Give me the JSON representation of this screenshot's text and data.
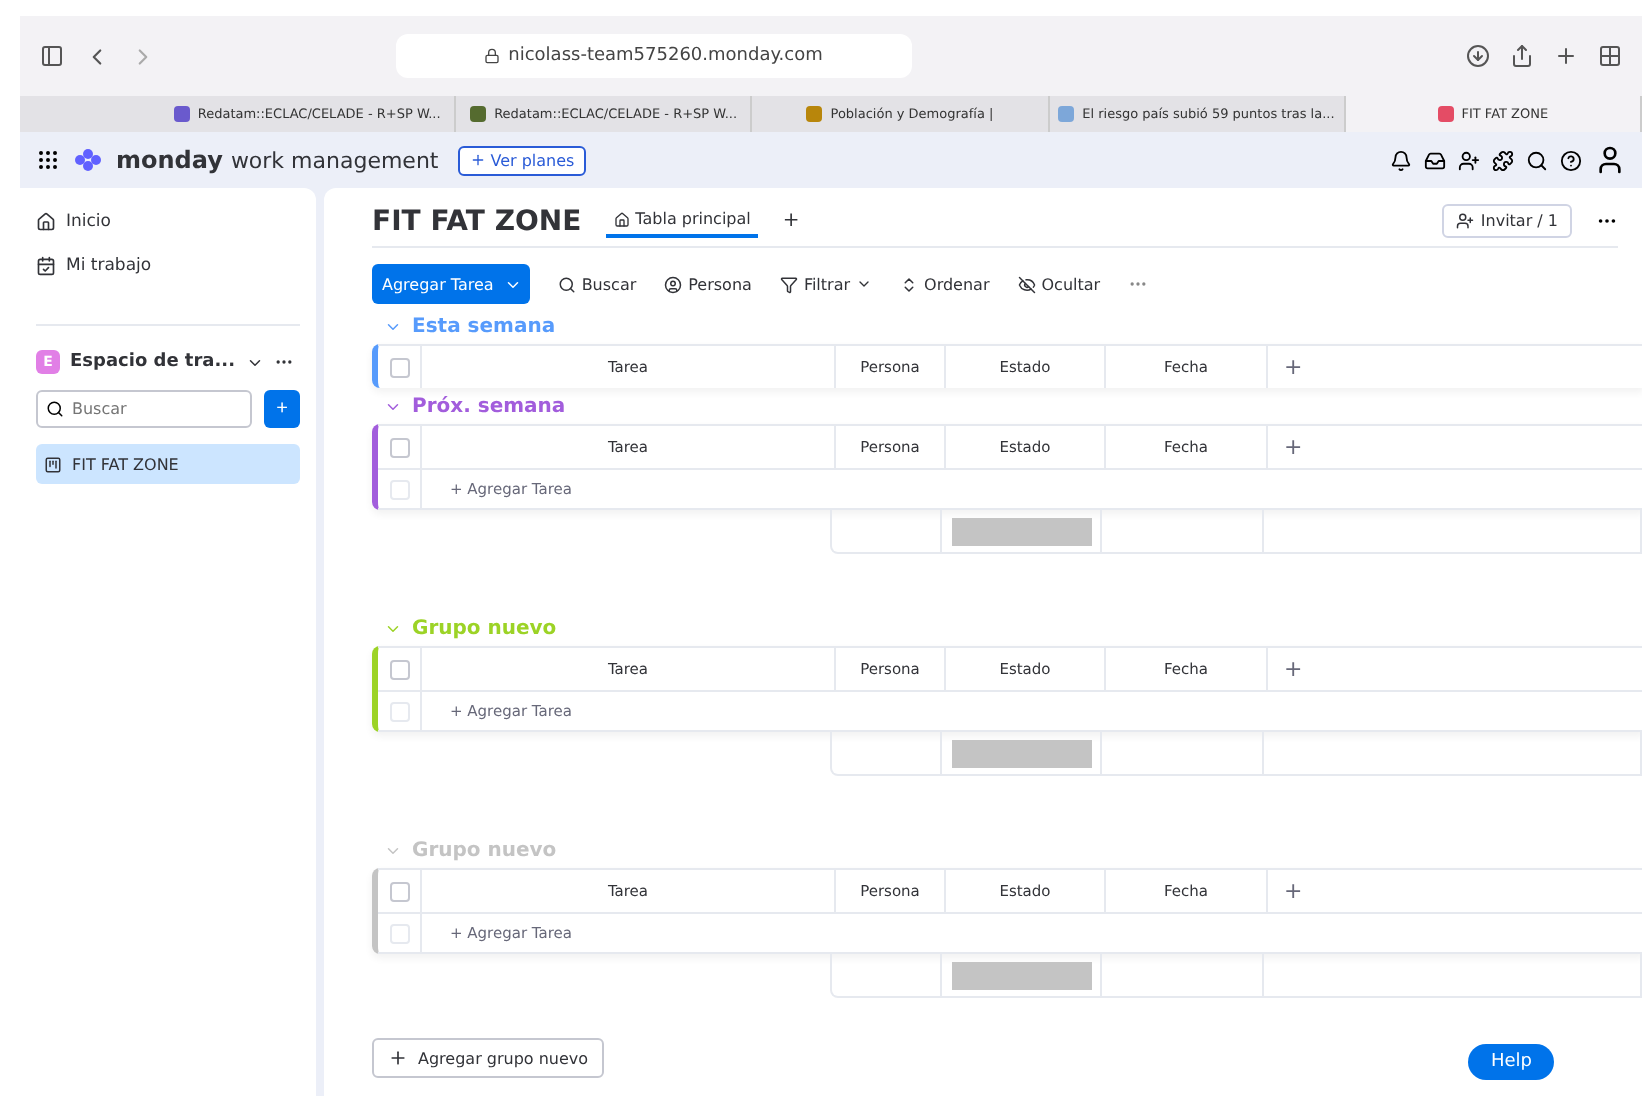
{
  "browser": {
    "url": "nicolass-team575260.monday.com",
    "tabs": [
      {
        "label": "Redatam::ECLAC/CELADE - R+SP W...",
        "selected": false
      },
      {
        "label": "Redatam::ECLAC/CELADE - R+SP W...",
        "selected": false
      },
      {
        "label": "Población y Demografía |",
        "selected": false
      },
      {
        "label": "El riesgo país subió 59 puntos tras la...",
        "selected": false
      },
      {
        "label": "FIT FAT ZONE",
        "selected": true
      }
    ]
  },
  "header": {
    "brand": "monday",
    "product": "work management",
    "plans_button": "Ver planes"
  },
  "sidebar": {
    "nav": [
      "Inicio",
      "Mi trabajo"
    ],
    "workspace": {
      "initial": "E",
      "name": "Espacio de tra..."
    },
    "search": {
      "placeholder": "Buscar"
    },
    "add": "+",
    "items": [
      {
        "label": "FIT FAT ZONE",
        "selected": true
      }
    ]
  },
  "board": {
    "title": "FIT FAT ZONE",
    "views": [
      {
        "label": "Tabla principal",
        "selected": true
      }
    ],
    "add_view": "+",
    "invite": "Invitar / 1",
    "toolbar": {
      "primary": "Agregar Tarea",
      "actions": [
        "Buscar",
        "Persona",
        "Filtrar",
        "Ordenar",
        "Ocultar"
      ]
    },
    "groups": [
      {
        "title": "Esta semana",
        "color": "#579bfc",
        "columns": [
          "Tarea",
          "Persona",
          "Estado",
          "Fecha"
        ],
        "add_column": "+",
        "header_checked": false,
        "summary": false
      },
      {
        "title": "Próx. semana",
        "color": "#a25ddc",
        "columns": [
          "Tarea",
          "Persona",
          "Estado",
          "Fecha"
        ],
        "add_column": "+",
        "header_checked": false,
        "add_row": "+ Agregar Tarea",
        "row_checked": false,
        "summary": true
      },
      {
        "title": "Grupo nuevo",
        "color": "#9cd326",
        "columns": [
          "Tarea",
          "Persona",
          "Estado",
          "Fecha"
        ],
        "add_column": "+",
        "header_checked": false,
        "add_row": "+ Agregar Tarea",
        "row_checked": false,
        "summary": true
      },
      {
        "title": "Grupo nuevo",
        "color": "#c4c4c4",
        "columns": [
          "Tarea",
          "Persona",
          "Estado",
          "Fecha"
        ],
        "add_column": "+",
        "header_checked": false,
        "add_row": "+ Agregar Tarea",
        "row_checked": false,
        "summary": true
      }
    ],
    "add_group": "Agregar grupo nuevo"
  },
  "help": "Help"
}
